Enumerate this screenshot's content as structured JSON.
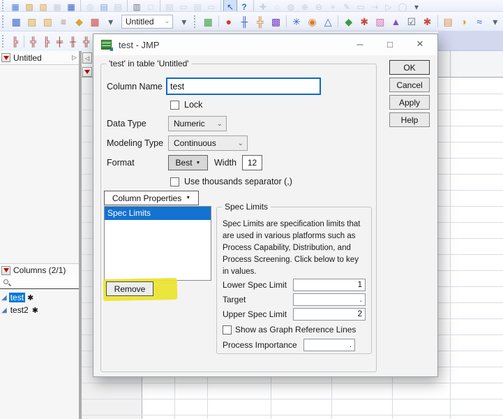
{
  "icons": {
    "collapse_left": "◁",
    "disclosure_right": "▷",
    "dropdown_chevron": "⌄",
    "solid_down_triangle": "▼",
    "asterisk_badge": "✱",
    "continuous_triangle": "◢",
    "minimize": "─",
    "maximize": "□",
    "close": "×"
  },
  "toolbar": {
    "table_combo_value": "Untitled",
    "row1": [
      {
        "type": "grip"
      },
      {
        "name": "new-data-table-icon",
        "glyph": "▦",
        "color": "#4a7fd4"
      },
      {
        "name": "open-script-icon",
        "glyph": "▨",
        "color": "#cfa12f"
      },
      {
        "name": "open-folder-icon",
        "glyph": "▧",
        "color": "#e0a63f"
      },
      {
        "name": "save-icon",
        "glyph": "▦",
        "color": "#c3c9d6",
        "disabled": true
      },
      {
        "name": "save-as-icon",
        "glyph": "▦",
        "color": "#3a5fc4"
      },
      {
        "type": "sep"
      },
      {
        "name": "find-icon",
        "glyph": "◎",
        "color": "#c3c9d6",
        "disabled": true
      },
      {
        "name": "copy-icon",
        "glyph": "▤",
        "color": "#7fa3d9"
      },
      {
        "name": "paste-icon",
        "glyph": "▤",
        "color": "#c3c9d6",
        "disabled": true
      },
      {
        "type": "sep"
      },
      {
        "name": "journal-icon",
        "glyph": "▥",
        "color": "#6e7989"
      },
      {
        "name": "layout-icon",
        "glyph": "□",
        "color": "#c3c9d6",
        "disabled": true
      },
      {
        "type": "sep"
      },
      {
        "name": "copy-window-icon",
        "glyph": "▤",
        "color": "#c9ced9",
        "disabled": true
      },
      {
        "name": "append-window-icon",
        "glyph": "▭",
        "color": "#c9ced9",
        "disabled": true
      },
      {
        "name": "new-journal-page-icon",
        "glyph": "▤",
        "color": "#c9ced9",
        "disabled": true
      },
      {
        "name": "blank-page-icon",
        "glyph": "▭",
        "color": "#c9ced9",
        "disabled": true
      },
      {
        "type": "sep"
      },
      {
        "name": "arrow-cursor-icon",
        "glyph": "↖",
        "color": "#1f4f9e",
        "active": true
      },
      {
        "name": "help-tool-icon",
        "glyph": "?",
        "color": "#2f6fce"
      },
      {
        "type": "sep"
      },
      {
        "name": "grabber-tool-icon",
        "glyph": "✚",
        "color": "#c3c9d6",
        "disabled": true
      },
      {
        "name": "lasso-tool-icon",
        "glyph": "◌",
        "color": "#c3c9d6",
        "disabled": true
      },
      {
        "name": "brush-tool-icon",
        "glyph": "◍",
        "color": "#c3c9d6",
        "disabled": true
      },
      {
        "name": "zoom-in-tool-icon",
        "glyph": "⊕",
        "color": "#c3c9d6",
        "disabled": true
      },
      {
        "name": "zoom-out-tool-icon",
        "glyph": "⊖",
        "color": "#c3c9d6",
        "disabled": true
      },
      {
        "name": "crosshair-tool-icon",
        "glyph": "+",
        "color": "#c3c9d6",
        "disabled": true
      },
      {
        "name": "pencil-tool-icon",
        "glyph": "✎",
        "color": "#c3c9d6",
        "disabled": true
      },
      {
        "name": "annotate-tool-icon",
        "glyph": "▭",
        "color": "#c3c9d6",
        "disabled": true
      },
      {
        "name": "connector-tool-icon",
        "glyph": "⇢",
        "color": "#c3c9d6",
        "disabled": true
      },
      {
        "name": "polygon-tool-icon",
        "glyph": "▷",
        "color": "#c3c9d6",
        "disabled": true
      },
      {
        "name": "oval-tool-icon",
        "glyph": "◯",
        "color": "#c3c9d6",
        "disabled": true
      },
      {
        "name": "toolbar-overflow-icon",
        "glyph": "▾",
        "color": "#5a6472"
      }
    ],
    "row2": [
      {
        "type": "grip"
      },
      {
        "name": "new-data-table-icon",
        "glyph": "▦",
        "color": "#3f63c9"
      },
      {
        "name": "open-script-icon",
        "glyph": "▨",
        "color": "#d9a43b"
      },
      {
        "name": "open-folder-icon",
        "glyph": "▧",
        "color": "#e0a63f"
      },
      {
        "name": "database-open-icon",
        "glyph": "≡",
        "color": "#b08968"
      },
      {
        "name": "save-session-icon",
        "glyph": "◆",
        "color": "#d9a43b"
      },
      {
        "name": "data-grid-icon",
        "glyph": "▦",
        "color": "#c94a3f"
      },
      {
        "name": "toolbar-overflow-icon",
        "glyph": "▾",
        "color": "#5a6472"
      },
      {
        "type": "combo",
        "name": "table-combobox"
      },
      {
        "name": "toolbar-overflow-icon",
        "glyph": "▾",
        "color": "#5a6472"
      },
      {
        "type": "grip"
      },
      {
        "name": "tile-windows-icon",
        "glyph": "▦",
        "color": "#3f9d3f"
      },
      {
        "type": "sep"
      },
      {
        "name": "graph-builder-icon",
        "glyph": "●",
        "color": "#d23c2e"
      },
      {
        "name": "distribution-icon",
        "glyph": "╫",
        "color": "#3f63c9"
      },
      {
        "name": "fit-y-by-x-icon",
        "glyph": "╬",
        "color": "#d9822b"
      },
      {
        "name": "cell-plot-icon",
        "glyph": "▩",
        "color": "#7a3fc9"
      },
      {
        "type": "sep"
      },
      {
        "name": "fit-model-icon",
        "glyph": "✳",
        "color": "#3f63c9"
      },
      {
        "name": "contour-profiler-icon",
        "glyph": "◉",
        "color": "#e07b2f"
      },
      {
        "name": "ternary-plot-icon",
        "glyph": "△",
        "color": "#3f63c9"
      },
      {
        "type": "sep"
      },
      {
        "name": "partition-icon",
        "glyph": "◆",
        "color": "#3f9d3f"
      },
      {
        "name": "time-series-icon",
        "glyph": "✱",
        "color": "#c94a3f"
      },
      {
        "name": "surface-plot-icon",
        "glyph": "▨",
        "color": "#d46fb0"
      },
      {
        "name": "mixture-profiler-icon",
        "glyph": "▲",
        "color": "#8a4fc9"
      },
      {
        "name": "control-chart-builder-icon",
        "glyph": "☑",
        "color": "#5a6472"
      },
      {
        "name": "variability-chart-icon",
        "glyph": "✱",
        "color": "#c94a3f"
      },
      {
        "type": "sep"
      },
      {
        "name": "tabulate-icon",
        "glyph": "▤",
        "color": "#e0883f"
      },
      {
        "name": "pie-chart-icon",
        "glyph": "◑",
        "color": "#d9a427"
      },
      {
        "name": "fit-curve-icon",
        "glyph": "≈",
        "color": "#3f63c9"
      },
      {
        "name": "toolbar-overflow-icon",
        "glyph": "▾",
        "color": "#5a6472"
      }
    ],
    "row3": [
      {
        "type": "grip"
      },
      {
        "name": "doe-custom-design-icon",
        "glyph": "╠",
        "color": "#9c3a32"
      },
      {
        "type": "sep"
      },
      {
        "name": "doe-screening-design-icon",
        "glyph": "╬",
        "color": "#9c3a32"
      },
      {
        "name": "doe-full-factorial-icon",
        "glyph": "╠",
        "color": "#9c3a32"
      },
      {
        "name": "doe-mixture-design-icon",
        "glyph": "╪",
        "color": "#9c3a32"
      },
      {
        "name": "doe-response-surface-icon",
        "glyph": "╫",
        "color": "#9c3a32"
      },
      {
        "name": "doe-taguchi-icon",
        "glyph": "╬",
        "color": "#9c3a32"
      }
    ]
  },
  "sidebar": {
    "table_panel": {
      "title": "Untitled"
    },
    "columns_panel": {
      "title": "Columns (2/1)",
      "items": [
        {
          "label": "test",
          "selected": true,
          "badge": "✱"
        },
        {
          "label": "test2",
          "selected": false,
          "badge": "✱"
        }
      ]
    }
  },
  "dialog": {
    "title": "test - JMP",
    "controls": [
      {
        "name": "minimize-button",
        "icon": "minimize"
      },
      {
        "name": "maximize-button",
        "icon": "maximize"
      },
      {
        "name": "close-button",
        "icon": "close"
      }
    ],
    "group_title": "'test' in table 'Untitled'",
    "column_name_label": "Column Name",
    "column_name_value": "test",
    "lock_label": "Lock",
    "data_type_label": "Data Type",
    "data_type_value": "Numeric",
    "modeling_type_label": "Modeling Type",
    "modeling_type_value": "Continuous",
    "format_label": "Format",
    "format_value": "Best",
    "width_label": "Width",
    "width_value": "12",
    "thousands_label": "Use thousands separator (,)",
    "column_properties_label": "Column Properties",
    "properties_list": [
      {
        "label": "Spec Limits",
        "selected": true
      }
    ],
    "remove_label": "Remove",
    "spec": {
      "group_title": "Spec Limits",
      "description": "Spec Limits are specification limits that are used in various platforms such as Process Capability, Distribution, and Process Screening. Click below to key in values.",
      "lower_label": "Lower Spec Limit",
      "lower_value": "1",
      "target_label": "Target",
      "target_value": ".",
      "upper_label": "Upper Spec Limit",
      "upper_value": "2",
      "show_ref_label": "Show as Graph Reference Lines",
      "process_importance_label": "Process Importance",
      "process_importance_value": "."
    },
    "buttons": [
      {
        "label": "OK",
        "default": true
      },
      {
        "label": "Cancel"
      },
      {
        "label": "Apply"
      },
      {
        "label": "Help"
      }
    ]
  }
}
